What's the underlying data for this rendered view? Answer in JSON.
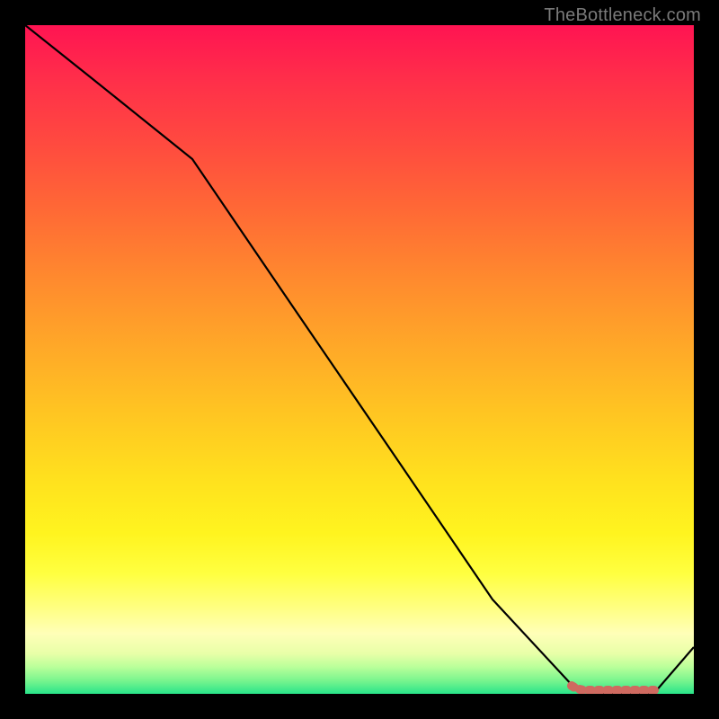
{
  "watermark": "TheBottleneck.com",
  "chart_data": {
    "type": "line",
    "title": "",
    "xlabel": "",
    "ylabel": "",
    "xlim": [
      0,
      100
    ],
    "ylim": [
      0,
      100
    ],
    "grid": false,
    "legend": false,
    "series": [
      {
        "name": "curve",
        "color": "#000000",
        "x": [
          0,
          10,
          25,
          40,
          55,
          70,
          82,
          86,
          90,
          94,
          100
        ],
        "y": [
          100,
          92,
          80,
          58,
          36,
          14,
          1,
          0,
          0,
          0,
          7
        ]
      },
      {
        "name": "highlight-band",
        "color": "#d16a61",
        "style": "thick-dashed",
        "x": [
          82,
          94
        ],
        "y": [
          0.7,
          0.7
        ]
      }
    ],
    "annotations": []
  }
}
